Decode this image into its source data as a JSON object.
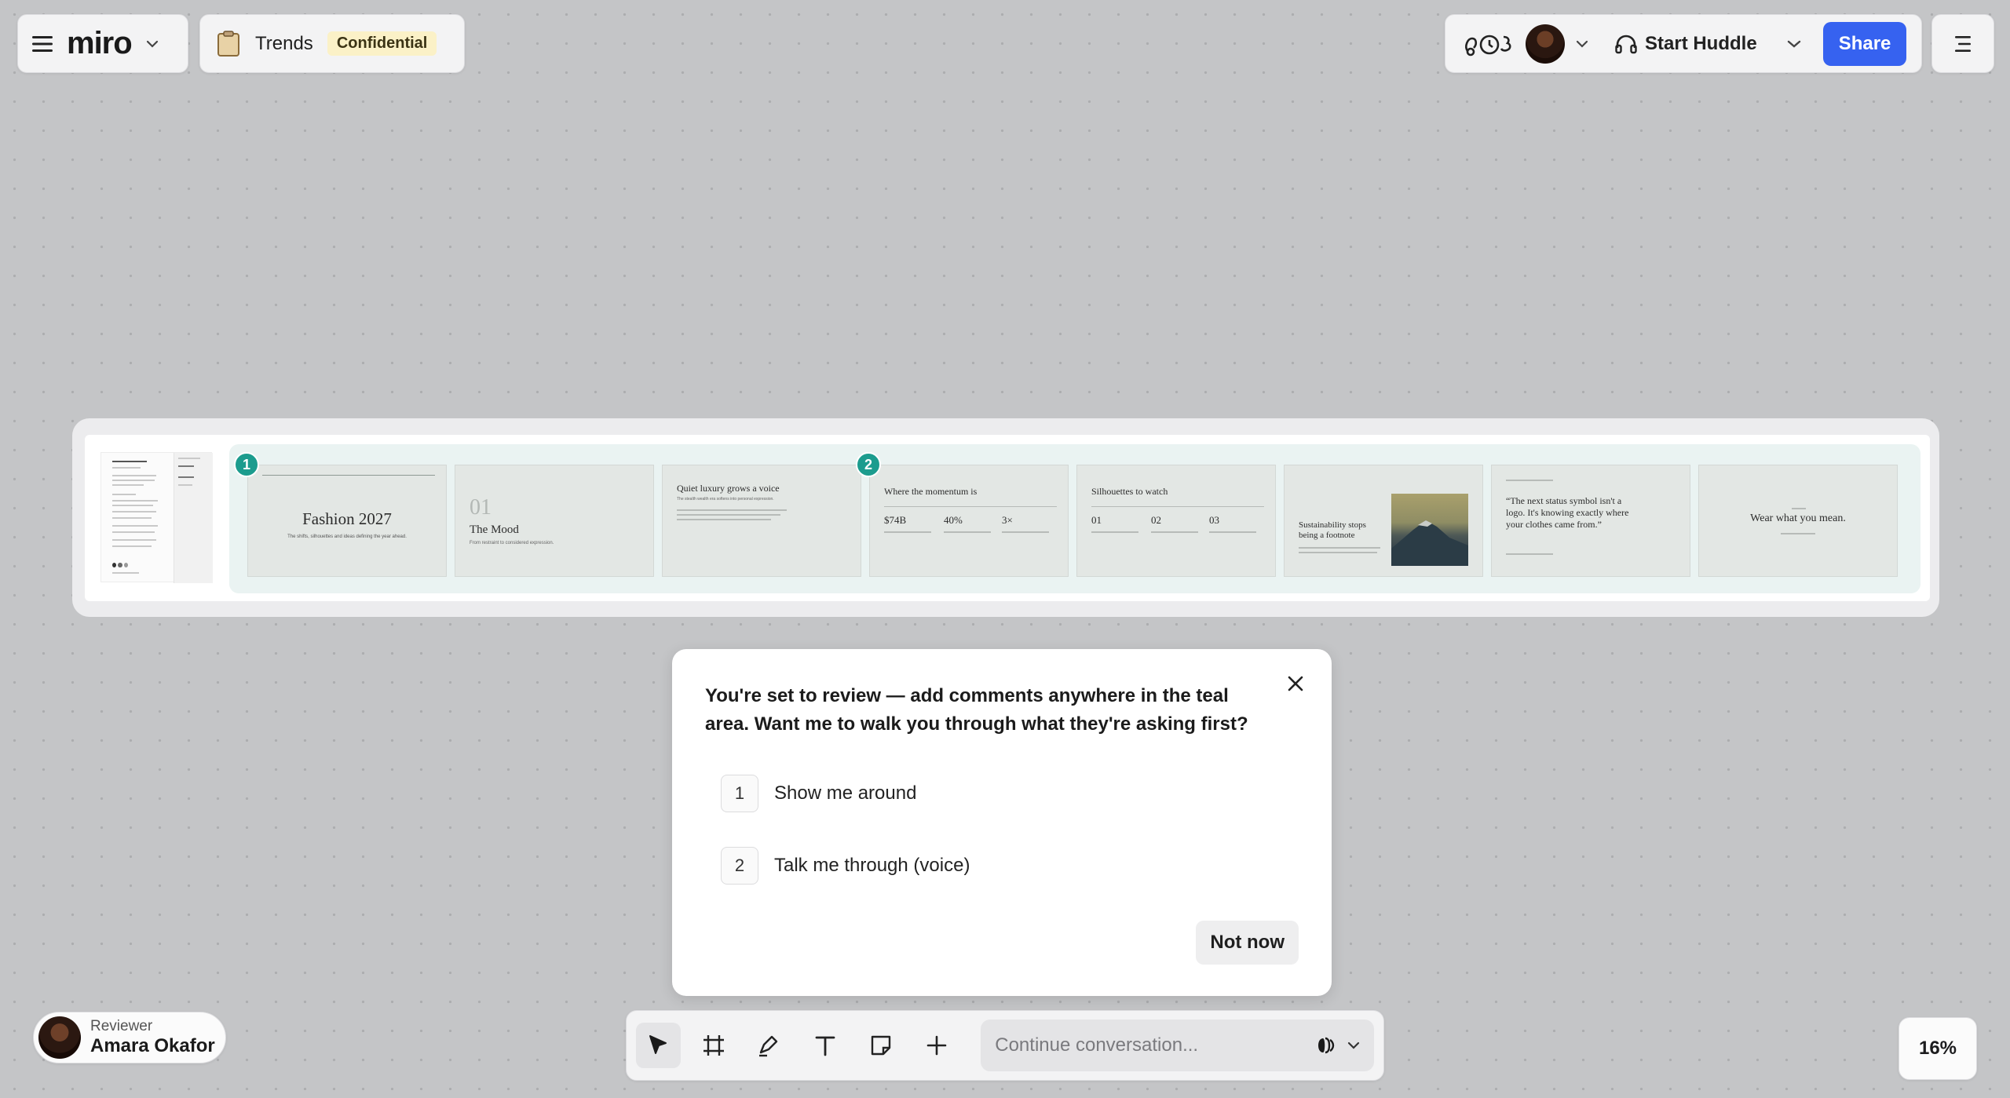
{
  "header": {
    "logo": "miro",
    "board_title": "Trends",
    "badge": "Confidential",
    "huddle_label": "Start Huddle",
    "share_label": "Share"
  },
  "slides": [
    {
      "num": "1",
      "title": "Fashion 2027",
      "sub": "The shifts, silhouettes and ideas defining the year ahead."
    },
    {
      "big": "01",
      "title": "The Mood",
      "sub": "From restraint to considered expression."
    },
    {
      "title": "Quiet luxury grows a voice",
      "sub": "The stealth wealth era softens into personal expression."
    },
    {
      "num": "2",
      "title": "Where the momentum is",
      "stats": [
        "$74B",
        "40%",
        "3×"
      ]
    },
    {
      "title": "Silhouettes to watch",
      "stats": [
        "01",
        "02",
        "03"
      ]
    },
    {
      "title": "Sustainability stops being a footnote"
    },
    {
      "title": "“The next status symbol isn't a logo. It's knowing exactly where your clothes came from.”"
    },
    {
      "title": "Wear what you mean."
    }
  ],
  "dialog": {
    "title": "You're set to review — add comments anywhere in the teal area. Want me to walk you through what they're asking first?",
    "options": [
      {
        "num": "1",
        "label": "Show me around"
      },
      {
        "num": "2",
        "label": "Talk me through (voice)"
      }
    ],
    "dismiss_label": "Not now"
  },
  "reviewer": {
    "role": "Reviewer",
    "name": "Amara Okafor"
  },
  "toolbar": {
    "conversation_placeholder": "Continue conversation..."
  },
  "zoom": "16%",
  "colors": {
    "accent": "#3662f0",
    "teal": "#1c9c8e",
    "badge_bg": "#fbf1c7"
  }
}
